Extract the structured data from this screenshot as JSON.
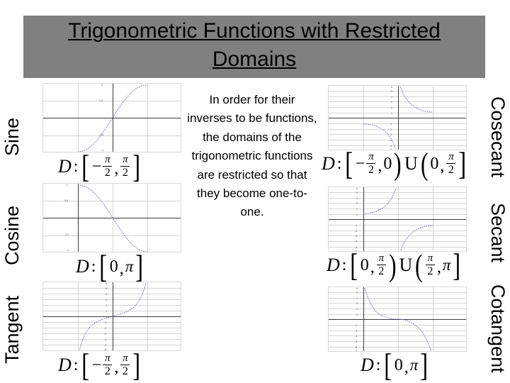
{
  "slide": {
    "title": "Trigonometric Functions with Restricted Domains",
    "title_band_color": "#808080",
    "background_color": "#ffffff",
    "body_text": "In order for their inverses to be functions, the domains of the trigonometric functions are restricted so that they become one-to-one.",
    "curve_color": "#6a6aa8",
    "grid_color": "#d4d4d4",
    "axis_color": "#3a3a3a"
  },
  "left_labels": [
    {
      "label": "Sine"
    },
    {
      "label": "Cosine"
    },
    {
      "label": "Tangent"
    }
  ],
  "right_labels": [
    {
      "label": "Cosecant"
    },
    {
      "label": "Secant"
    },
    {
      "label": "Cotangent"
    }
  ],
  "graphs": [
    {
      "id": "sine",
      "function_name": "Sine",
      "domain_text": "D : [ -π/2 , π/2 ]",
      "yticks": [
        "1",
        "0.5",
        "-0.5",
        "-1"
      ],
      "ylim": [
        -1,
        1
      ]
    },
    {
      "id": "cosine",
      "function_name": "Cosine",
      "domain_text": "D : [ 0 , π ]",
      "yticks": [
        "1",
        "0.5",
        "-0.5",
        "-1"
      ],
      "ylim": [
        -1,
        1
      ]
    },
    {
      "id": "tangent",
      "function_name": "Tangent",
      "domain_text": "D : [ -π/2 , π/2 ]",
      "yticks": [
        "6",
        "5",
        "4",
        "3",
        "2",
        "1",
        "-1",
        "-2",
        "-3",
        "-4",
        "-5",
        "-6"
      ],
      "ylim": [
        -6,
        6
      ]
    },
    {
      "id": "cosecant",
      "function_name": "Cosecant",
      "domain_text": "D : [ -π/2 , 0 ) U ( 0 , π/2 ]",
      "yticks": [
        "6",
        "5",
        "4",
        "3",
        "2",
        "1",
        "-1",
        "-2",
        "-3",
        "-4",
        "-5",
        "-6"
      ],
      "ylim": [
        -6,
        6
      ]
    },
    {
      "id": "secant",
      "function_name": "Secant",
      "domain_text": "D : [ 0 , π/2 ) U ( π/2 , π ]",
      "yticks": [
        "6",
        "5",
        "4",
        "3",
        "2",
        "1",
        "-1",
        "-2",
        "-3",
        "-4",
        "-5",
        "-6"
      ],
      "ylim": [
        -6,
        6
      ]
    },
    {
      "id": "cotangent",
      "function_name": "Cotangent",
      "domain_text": "D : [ 0 , π ]",
      "yticks": [
        "6",
        "5",
        "4",
        "3",
        "2",
        "1",
        "-1",
        "-2",
        "-3",
        "-4",
        "-5",
        "-6"
      ],
      "ylim": [
        -6,
        6
      ]
    }
  ],
  "math_tokens": {
    "D": "D",
    "colon": ":",
    "minus": "−",
    "comma": ",",
    "zero": "0",
    "two": "2",
    "pi": "π",
    "cup": "U",
    "lbrack": "[",
    "rbrack": "]",
    "lparen": "(",
    "rparen": ")"
  }
}
